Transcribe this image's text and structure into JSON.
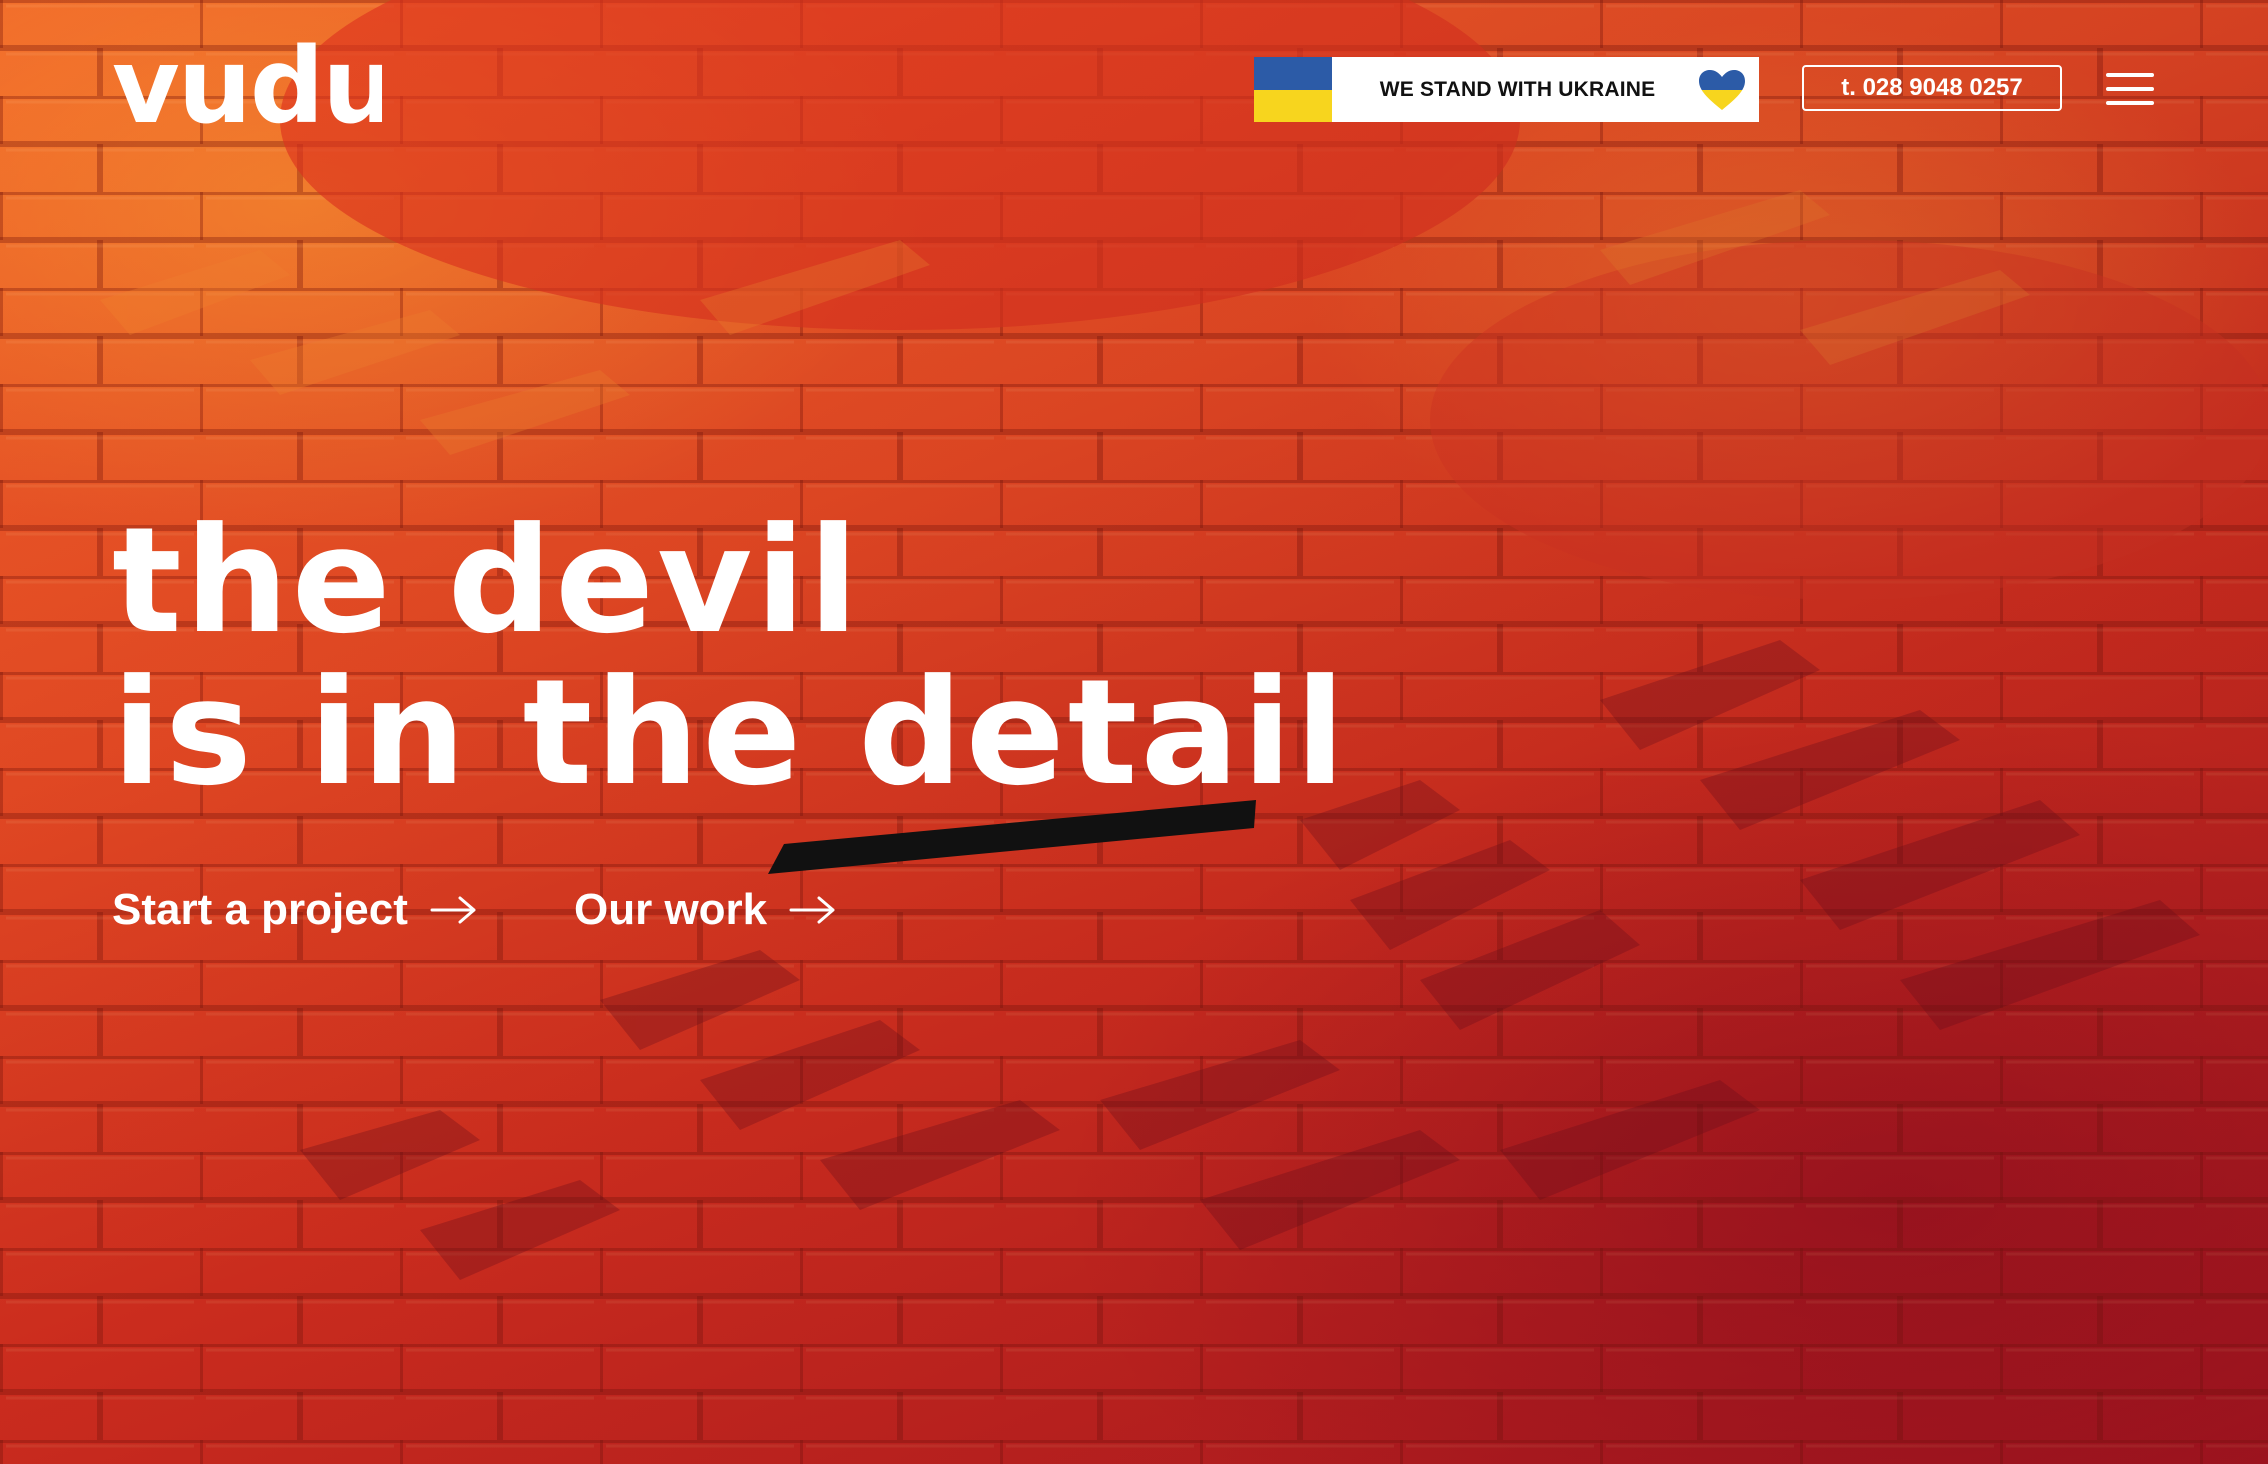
{
  "brand": {
    "logo_text": "vudu"
  },
  "header": {
    "ukraine_banner_text": "WE STAND WITH UKRAINE",
    "phone_label": "t. 028 9048 0257",
    "colors": {
      "flag_blue": "#2c5ba7",
      "flag_yellow": "#f7d51e"
    }
  },
  "hero": {
    "headline_line1": "the devil",
    "headline_line2": "is in the detail",
    "cta_start": "Start a project",
    "cta_work": "Our work"
  },
  "icons": {
    "menu": "hamburger-icon",
    "arrow": "arrow-right-icon",
    "heart": "heart-icon"
  }
}
